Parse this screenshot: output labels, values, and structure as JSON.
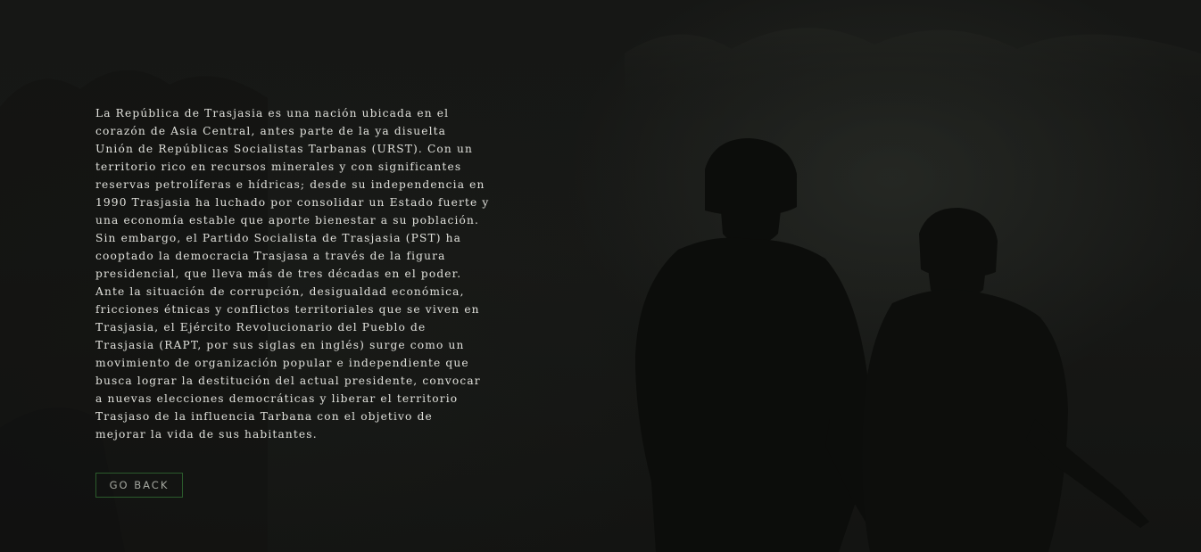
{
  "article": {
    "paragraph": "La República de Trasjasia es una nación ubicada en el\ncorazón de Asia Central, antes parte de la ya disuelta\nUnión de Repúblicas Socialistas Tarbanas (URST). Con un\nterritorio rico en recursos minerales y con significantes\nreservas petrolíferas e hídricas; desde su independencia en\n1990 Trasjasia ha luchado por consolidar un Estado fuerte y\nuna economía estable que aporte bienestar a su población.\nSin embargo, el Partido Socialista de Trasjasia (PST) ha\ncooptado la democracia Trasjasa a través de la figura\npresidencial, que lleva más de tres décadas en el poder.\nAnte la situación de corrupción, desigualdad económica,\nfricciones étnicas y conflictos territoriales que se viven en\nTrasjasia, el Ejército Revolucionario del Pueblo de\nTrasjasia (RAPT, por sus siglas en inglés) surge como un\nmovimiento de organización popular e independiente que\nbusca lograr la destitución del actual presidente, convocar\na nuevas elecciones democráticas y liberar el territorio\nTrasjaso de la influencia Tarbana con el objetivo de\nmejorar la vida de sus habitantes."
  },
  "actions": {
    "go_back_label": "GO BACK"
  },
  "colors": {
    "background": "#141513",
    "text": "#e1e1dc",
    "button_border": "#2b5b2c",
    "button_text": "#a5a8a0"
  }
}
